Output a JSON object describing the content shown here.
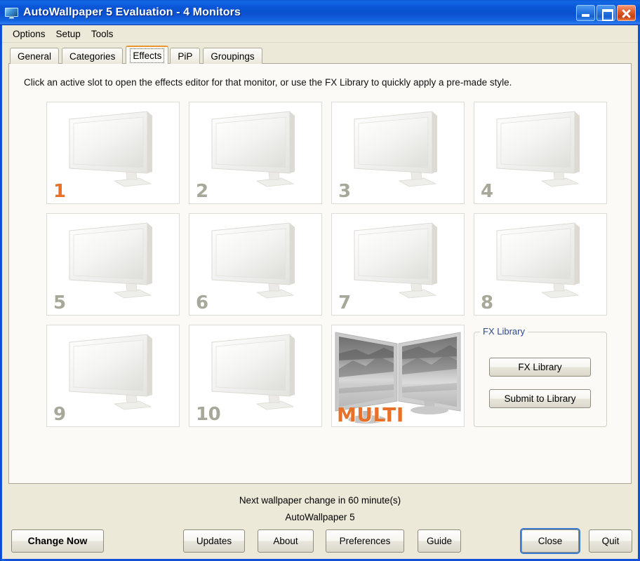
{
  "window": {
    "title": "AutoWallpaper 5 Evaluation - 4 Monitors",
    "icon": "monitor-icon",
    "controls": {
      "minimize": "minimize-icon",
      "maximize": "maximize-icon",
      "close": "close-icon"
    }
  },
  "menubar": {
    "items": [
      {
        "label": "Options"
      },
      {
        "label": "Setup"
      },
      {
        "label": "Tools"
      }
    ]
  },
  "tabs": [
    {
      "label": "General",
      "active": false
    },
    {
      "label": "Categories",
      "active": false
    },
    {
      "label": "Effects",
      "active": true
    },
    {
      "label": "PiP",
      "active": false
    },
    {
      "label": "Groupings",
      "active": false
    }
  ],
  "effects_page": {
    "hint": "Click an active slot to open the effects editor for that monitor, or use the FX Library to quickly apply a pre-made style.",
    "slots": [
      {
        "number": "1",
        "state": "active",
        "art": "single-monitor"
      },
      {
        "number": "2",
        "state": "inactive",
        "art": "single-monitor"
      },
      {
        "number": "3",
        "state": "inactive",
        "art": "single-monitor"
      },
      {
        "number": "4",
        "state": "inactive",
        "art": "single-monitor"
      },
      {
        "number": "5",
        "state": "inactive",
        "art": "single-monitor"
      },
      {
        "number": "6",
        "state": "inactive",
        "art": "single-monitor"
      },
      {
        "number": "7",
        "state": "inactive",
        "art": "single-monitor"
      },
      {
        "number": "8",
        "state": "inactive",
        "art": "single-monitor"
      },
      {
        "number": "9",
        "state": "inactive",
        "art": "single-monitor"
      },
      {
        "number": "10",
        "state": "inactive",
        "art": "single-monitor"
      },
      {
        "number": "MULTI",
        "state": "multi",
        "art": "dual-monitor-preview"
      }
    ],
    "fx_library": {
      "legend": "FX Library",
      "open_button": "FX Library",
      "submit_button": "Submit to Library"
    }
  },
  "status": {
    "next_change": "Next wallpaper change in 60 minute(s)",
    "app_name": "AutoWallpaper 5"
  },
  "buttons": {
    "change_now": "Change Now",
    "updates": "Updates",
    "about": "About",
    "preferences": "Preferences",
    "guide": "Guide",
    "close": "Close",
    "quit": "Quit"
  },
  "colors": {
    "accent_orange": "#e8712a",
    "titlebar_blue": "#0b51d0",
    "dialog_face": "#ece9d8",
    "page_face": "#fbfaf7",
    "inactive_number": "#a8a89a",
    "legend_blue": "#2a4a8c",
    "focus_blue": "#3a7bd4"
  }
}
